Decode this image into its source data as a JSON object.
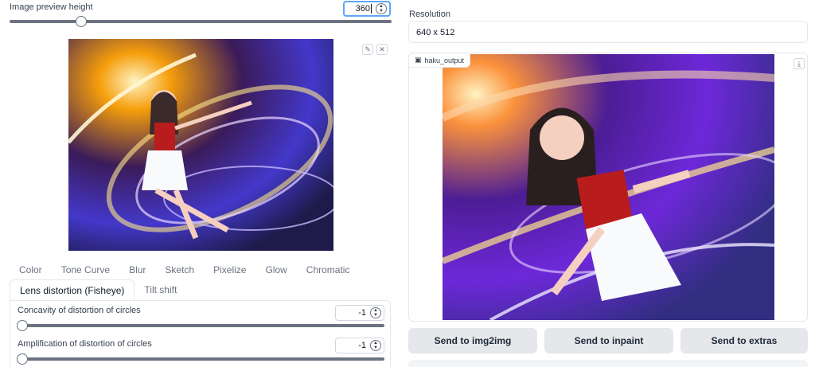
{
  "left": {
    "preview_height": {
      "label": "Image preview height",
      "value": "360",
      "slider_fraction": 0.18
    },
    "editor": {
      "edit_icon": "pencil-icon",
      "close_icon": "close-icon"
    },
    "tabs_row1": [
      "Color",
      "Tone Curve",
      "Blur",
      "Sketch",
      "Pixelize",
      "Glow",
      "Chromatic"
    ],
    "tabs_row2": {
      "active": "Lens distortion (Fisheye)",
      "inactive": "Tilt shift"
    },
    "concavity": {
      "label": "Concavity of distortion of circles",
      "value": "-1",
      "slider_fraction": 0.0
    },
    "amplification": {
      "label": "Amplification of distortion of circles",
      "value": "-1",
      "slider_fraction": 0.0
    }
  },
  "right": {
    "resolution": {
      "label": "Resolution",
      "value": "640 x 512"
    },
    "output": {
      "tag": "haku_output",
      "tag_icon": "image-icon",
      "download_icon": "download-icon"
    },
    "buttons": {
      "img2img": "Send to img2img",
      "inpaint": "Send to inpaint",
      "extras": "Send to extras"
    }
  },
  "colors": {
    "accent_focus": "#60a5fa",
    "button_bg": "#e5e7eb",
    "border": "#e5e7eb"
  }
}
